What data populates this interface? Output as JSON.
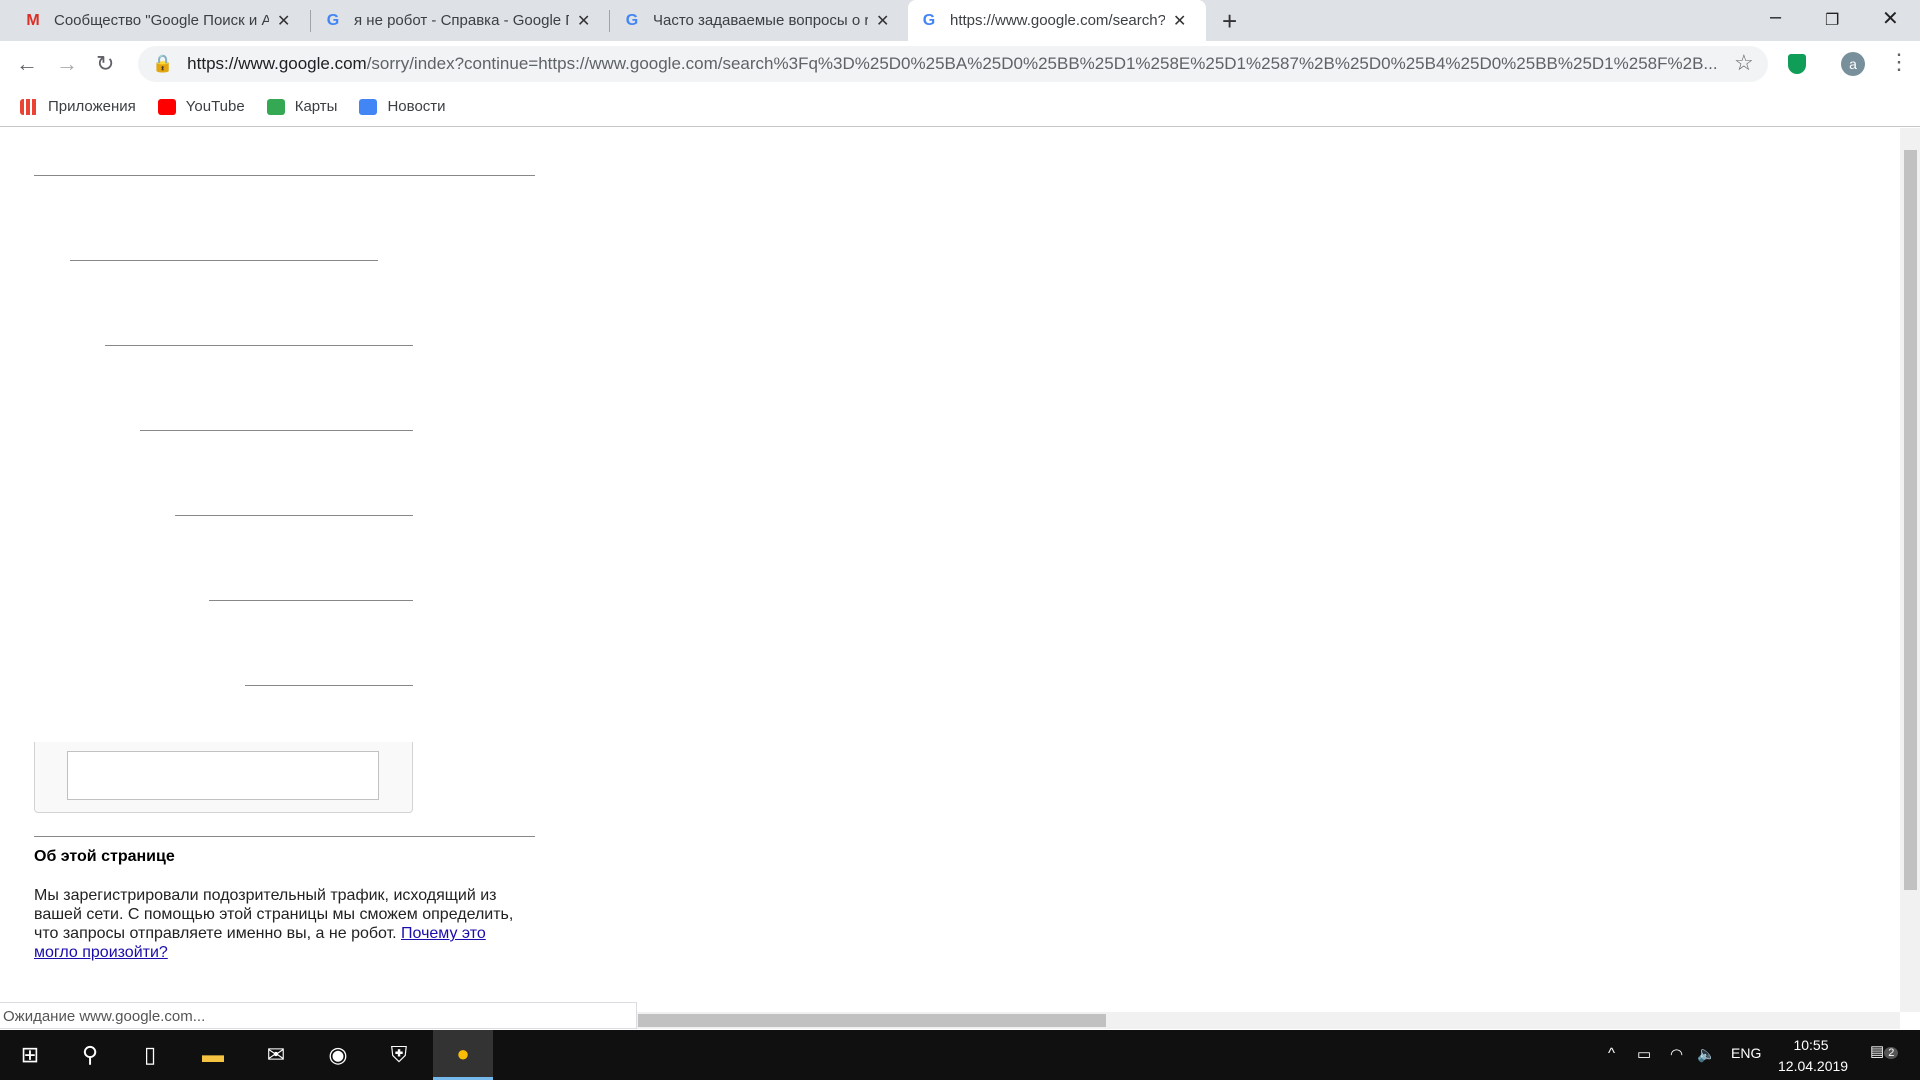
{
  "tabs": [
    {
      "title": "Сообщество \"Google Поиск и Ассистент\"",
      "icon": "gmail-icon"
    },
    {
      "title": "я не робот - Справка - Google Поиск",
      "icon": "google-icon"
    },
    {
      "title": "Часто задаваемые вопросы о reCAPTCHA",
      "icon": "google-icon"
    },
    {
      "title": "https://www.google.com/search?q",
      "icon": "google-icon",
      "active": true
    }
  ],
  "address": {
    "host": "https://www.google.com",
    "path": "/sorry/index?continue=https://www.google.com/search%3Fq%3D%25D0%25BA%25D0%25BB%25D1%258E%25D1%2587%2B%25D0%25B4%25D0%25BB%25D1%258F%2B..."
  },
  "profile_initial": "a",
  "bookmarks": [
    {
      "label": "Приложения",
      "color": "#ea4335"
    },
    {
      "label": "YouTube",
      "color": "#ff0000"
    },
    {
      "label": "Карты",
      "color": "#34a853"
    },
    {
      "label": "Новости",
      "color": "#4285f4"
    }
  ],
  "about": {
    "heading": "Об этой странице",
    "text": "Мы зарегистрировали подозрительный трафик, исходящий из вашей сети. С помощью этой страницы мы сможем определить, что запросы отправляете именно вы, а не робот. ",
    "link": "Почему это могло произойти?"
  },
  "status": "Ожидание www.google.com...",
  "tray": {
    "lang": "ENG",
    "time": "10:55",
    "date": "12.04.2019",
    "notifications": "2"
  }
}
